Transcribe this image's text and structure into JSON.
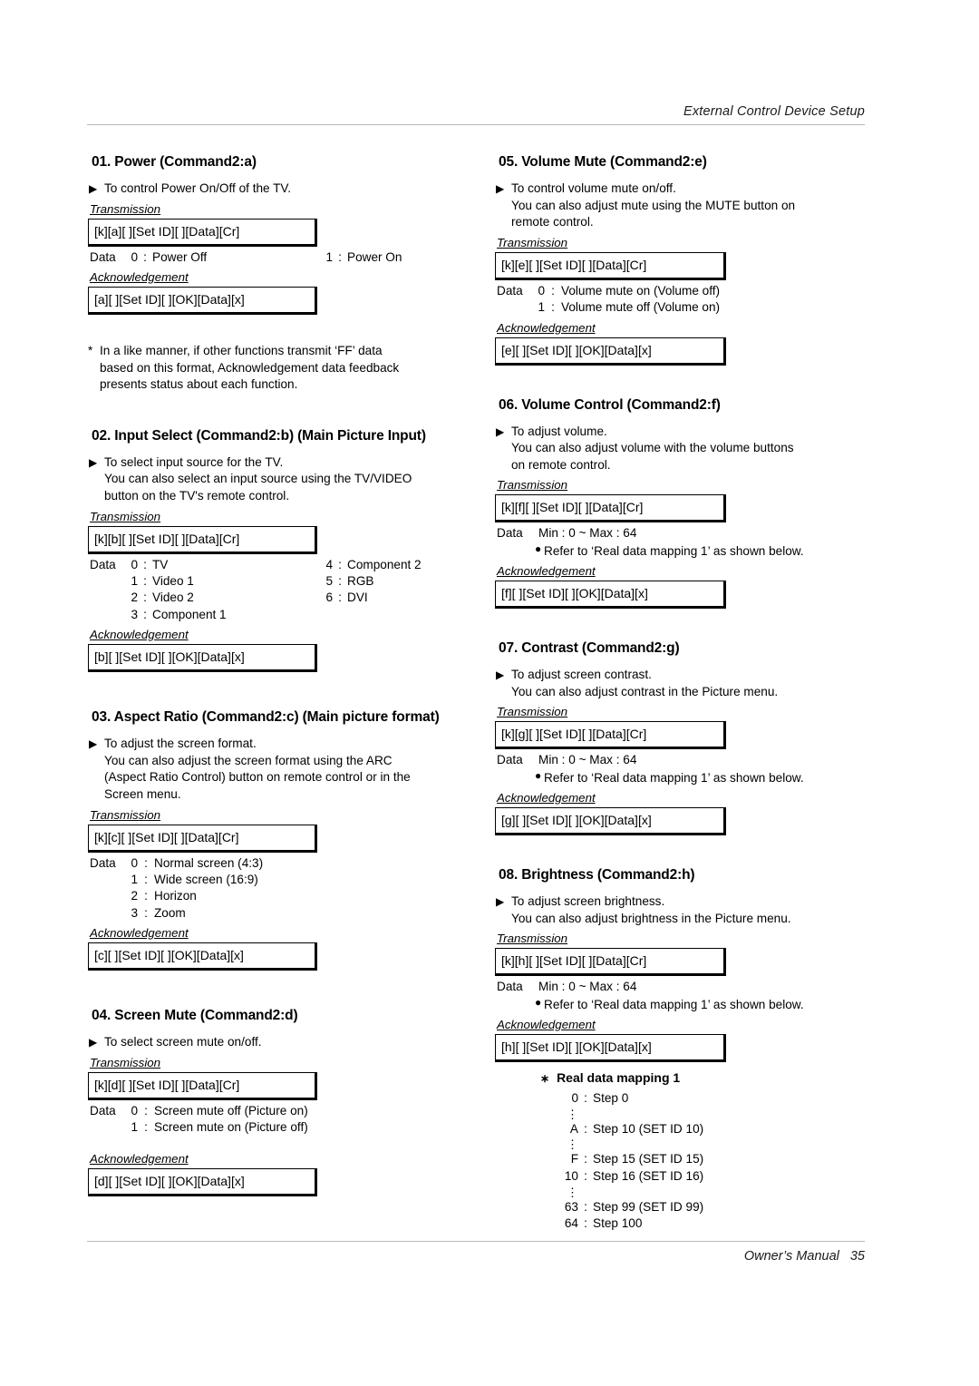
{
  "header": {
    "title": "External Control Device Setup"
  },
  "footer": {
    "manual": "Owner’s Manual",
    "page": "35"
  },
  "icons": {
    "triangle": "▶",
    "bullet": "●",
    "star": "*",
    "star_small": "∗",
    "vdots": "⋮"
  },
  "labels": {
    "transmission": "Transmission",
    "acknowledgement": "Acknowledgement",
    "data": "Data",
    "colon": ":"
  },
  "sections": [
    {
      "id": "01",
      "title": "01. Power (Command2:a)",
      "desc": [
        "To control Power On/Off of the TV."
      ],
      "transmission": "[k][a][  ][Set ID][  ][Data][Cr]",
      "data_rows": [
        {
          "key": "0",
          "value": "Power Off"
        }
      ],
      "data_rows_col2": [
        {
          "key": "1",
          "value": "Power On"
        }
      ],
      "acknowledgement": "[a][  ][Set ID][  ][OK][Data][x]",
      "note": [
        "In a like manner, if other functions transmit ‘FF’ data",
        "based on this format, Acknowledgement data feedback",
        "presents status about each function."
      ]
    },
    {
      "id": "02",
      "title": "02. Input Select (Command2:b) (Main Picture Input)",
      "desc": [
        "To select input source for the TV.",
        "You can also select an input source using the TV/VIDEO",
        "button on the TV's remote control."
      ],
      "transmission": "[k][b][  ][Set ID][  ][Data][Cr]",
      "data_rows": [
        {
          "key": "0",
          "value": "TV"
        },
        {
          "key": "1",
          "value": "Video 1"
        },
        {
          "key": "2",
          "value": "Video 2"
        },
        {
          "key": "3",
          "value": "Component 1"
        }
      ],
      "data_rows_col2": [
        {
          "key": "4",
          "value": "Component 2"
        },
        {
          "key": "5",
          "value": "RGB"
        },
        {
          "key": "6",
          "value": "DVI"
        }
      ],
      "acknowledgement": "[b][  ][Set ID][  ][OK][Data][x]"
    },
    {
      "id": "03",
      "title": "03. Aspect Ratio (Command2:c) (Main picture format)",
      "desc": [
        "To adjust the screen format.",
        "You can also adjust the screen format using the ARC",
        "(Aspect Ratio Control) button on remote control or in the",
        "Screen menu."
      ],
      "transmission": "[k][c][  ][Set ID][  ][Data][Cr]",
      "data_rows": [
        {
          "key": "0",
          "value": "Normal screen (4:3)"
        },
        {
          "key": "1",
          "value": "Wide screen (16:9)"
        },
        {
          "key": "2",
          "value": "Horizon"
        },
        {
          "key": "3",
          "value": "Zoom"
        }
      ],
      "acknowledgement": "[c][  ][Set ID][  ][OK][Data][x]"
    },
    {
      "id": "04",
      "title": "04. Screen Mute (Command2:d)",
      "desc": [
        "To select screen mute on/off."
      ],
      "transmission": "[k][d][  ][Set ID][  ][Data][Cr]",
      "data_rows": [
        {
          "key": "0",
          "value": "Screen mute off (Picture on)"
        },
        {
          "key": "1",
          "value": "Screen mute on (Picture off)"
        }
      ],
      "acknowledgement": "[d][  ][Set ID][  ][OK][Data][x]"
    },
    {
      "id": "05",
      "title": "05. Volume Mute (Command2:e)",
      "desc": [
        "To control volume mute on/off.",
        "You can also adjust mute using the MUTE button on",
        "remote control."
      ],
      "transmission": "[k][e][  ][Set ID][  ][Data][Cr]",
      "data_rows": [
        {
          "key": "0",
          "value": "Volume mute on (Volume off)"
        },
        {
          "key": "1",
          "value": "Volume mute off (Volume on)"
        }
      ],
      "acknowledgement": "[e][  ][Set ID][  ][OK][Data][x]"
    },
    {
      "id": "06",
      "title": "06. Volume Control (Command2:f)",
      "desc": [
        "To adjust volume.",
        "You can also adjust volume with the volume buttons",
        "on remote control."
      ],
      "transmission": "[k][f][  ][Set ID][  ][Data][Cr]",
      "minmax": "Min : 0 ~ Max : 64",
      "refer": "Refer to ‘Real data mapping 1’ as shown below.",
      "acknowledgement": "[f][  ][Set ID][  ][OK][Data][x]"
    },
    {
      "id": "07",
      "title": "07. Contrast (Command2:g)",
      "desc": [
        "To adjust screen contrast.",
        "You can also adjust contrast in the Picture menu."
      ],
      "transmission": "[k][g][  ][Set ID][  ][Data][Cr]",
      "minmax": "Min : 0 ~ Max : 64",
      "refer": "Refer to ‘Real data mapping 1’ as shown below.",
      "acknowledgement": "[g][  ][Set ID][  ][OK][Data][x]"
    },
    {
      "id": "08",
      "title": "08. Brightness (Command2:h)",
      "desc": [
        "To adjust screen brightness.",
        "You can also adjust brightness in the Picture menu."
      ],
      "transmission": "[k][h][  ][Set ID][  ][Data][Cr]",
      "minmax": "Min : 0 ~ Max : 64",
      "refer": "Refer to ‘Real data mapping 1’ as shown below.",
      "acknowledgement": "[h][  ][Set ID][  ][OK][Data][x]"
    }
  ],
  "mapping": {
    "title": "Real data mapping 1",
    "rows": [
      {
        "type": "row",
        "key": "0",
        "value": "Step 0"
      },
      {
        "type": "dots"
      },
      {
        "type": "row",
        "key": "A",
        "value": "Step 10 (SET ID 10)"
      },
      {
        "type": "dots"
      },
      {
        "type": "row",
        "key": "F",
        "value": "Step 15 (SET ID 15)"
      },
      {
        "type": "row",
        "key": "10",
        "value": "Step 16 (SET ID 16)"
      },
      {
        "type": "dots"
      },
      {
        "type": "row",
        "key": "63",
        "value": "Step 99 (SET ID 99)"
      },
      {
        "type": "row",
        "key": "64",
        "value": "Step 100"
      }
    ]
  }
}
